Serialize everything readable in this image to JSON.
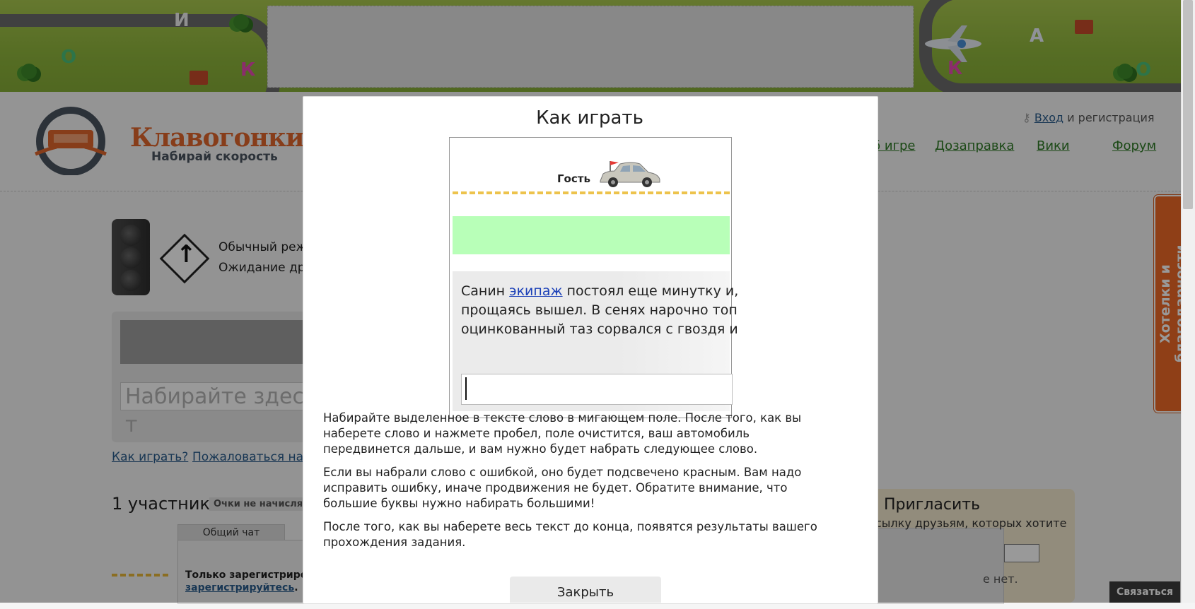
{
  "header": {
    "logo_title": "Клавогонки",
    "logo_subtitle": "Набирай скорость",
    "login_link": "Вход",
    "login_rest": " и регистрация",
    "nav": [
      "б игре",
      "Дозаправка",
      "Вики",
      "Форум"
    ]
  },
  "banner_letters": [
    "И",
    "О",
    "К",
    "А",
    "К",
    "О"
  ],
  "game": {
    "mode_line1": "Обычный режи",
    "mode_line2": "Ожидание дру",
    "input_placeholder": "Набирайте здесь т",
    "howto_link": "Как играть?",
    "complain_link": "Пожаловаться на те",
    "participants": "1 участник",
    "points_badge": "Очки не начисля"
  },
  "chat": {
    "tab": "Общий чат",
    "note": "Только зарегистриров",
    "reg_link": "зарегистрируйтесь",
    "reg_tail": "."
  },
  "invite": {
    "title": "Пригласить",
    "text": "сылку друзьям, которых хотите",
    "none": "е нет."
  },
  "sidetab": "Хотелки и благодарности",
  "contact_button": "Связаться",
  "modal": {
    "title": "Как играть",
    "demo": {
      "player": "Гость",
      "line1_pre": "Санин ",
      "line1_word": "экипаж",
      "line1_post": " постоял еще минутку и,",
      "line2": "прощаясь вышел. В сенях нарочно топ",
      "line3": "оцинкованный таз сорвался с гвоздя и"
    },
    "p1": "Набирайте выделенное в тексте слово в мигающем поле. После того, как вы наберете слово и нажмете пробел, поле очистится, ваш автомобиль передвинется дальше, и вам нужно будет набрать следующее слово.",
    "p2": "Если вы набрали слово с ошибкой, оно будет подсвечено красным. Вам надо исправить ошибку, иначе продвижения не будет. Обратите внимание, что большие буквы нужно набирать большими!",
    "p3": "После того, как вы наберете весь текст до конца, появятся результаты вашего прохождения задания.",
    "close_button": "Закрыть"
  },
  "colors": {
    "brand_orange": "#e1662c",
    "nav_green": "#2e7a25",
    "link_blue": "#2a5d8c",
    "demo_green": "#b8ffb8"
  }
}
